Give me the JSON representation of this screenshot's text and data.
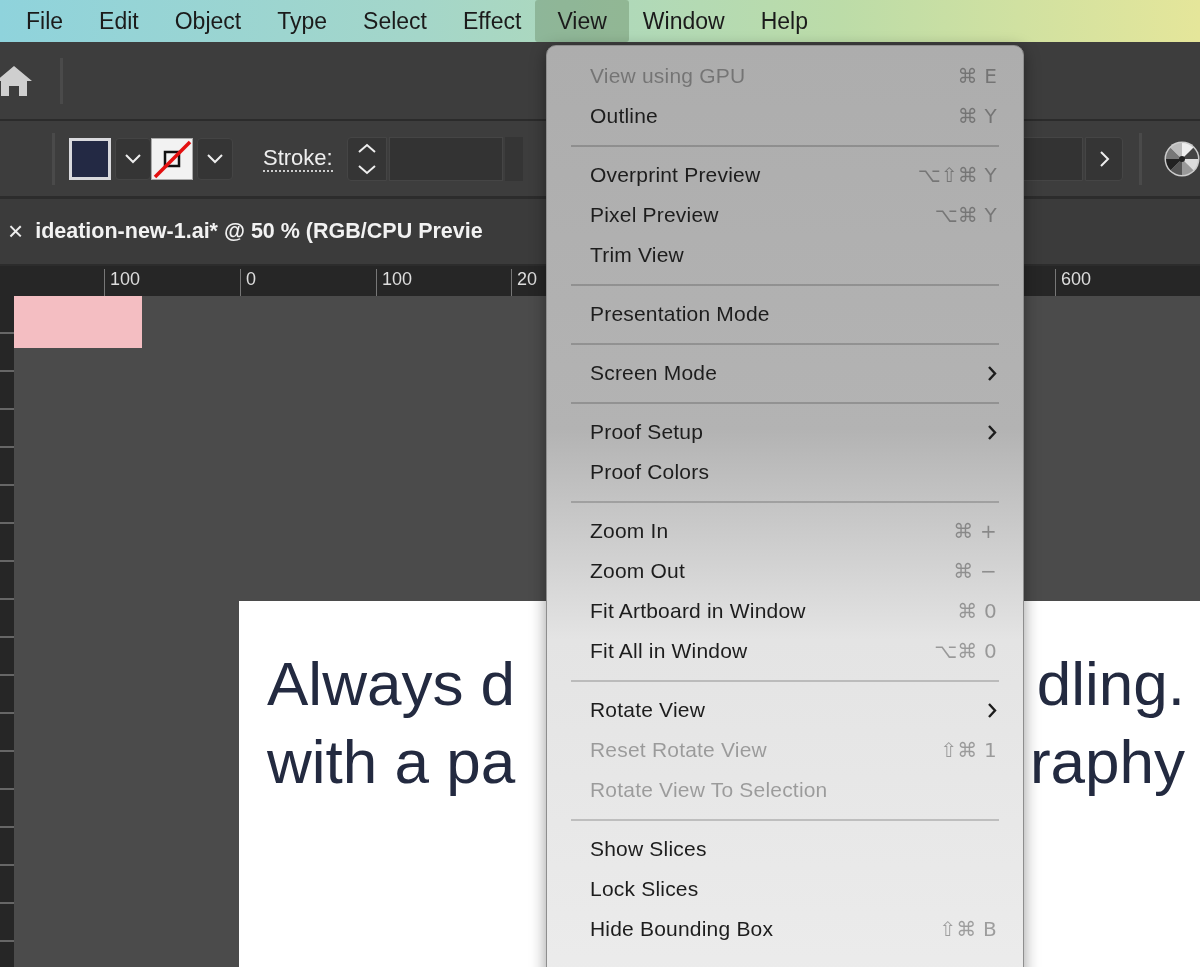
{
  "menu_bar": {
    "items": [
      {
        "label": "File",
        "selected": false
      },
      {
        "label": "Edit",
        "selected": false
      },
      {
        "label": "Object",
        "selected": false
      },
      {
        "label": "Type",
        "selected": false
      },
      {
        "label": "Select",
        "selected": false
      },
      {
        "label": "Effect",
        "selected": false
      },
      {
        "label": "View",
        "selected": true
      },
      {
        "label": "Window",
        "selected": false
      },
      {
        "label": "Help",
        "selected": false
      }
    ]
  },
  "control_bar": {
    "stroke_label": "Stroke:"
  },
  "document_tab": {
    "close": "×",
    "title": "ideation-new-1.ai* @ 50 % (RGB/CPU Previe"
  },
  "ruler": {
    "labels": [
      "100",
      "0",
      "100",
      "20",
      "600"
    ]
  },
  "artboard": {
    "lines": [
      {
        "left": "Always d",
        "right": "dling."
      },
      {
        "left": "with a pa",
        "right": "raphy"
      }
    ]
  },
  "view_menu": {
    "groups": [
      [
        {
          "label": "View using GPU",
          "shortcut": "⌘ E",
          "disabled": true,
          "submenu": false
        },
        {
          "label": "Outline",
          "shortcut": "⌘ Y",
          "disabled": false,
          "submenu": false
        }
      ],
      [
        {
          "label": "Overprint Preview",
          "shortcut": "⌥⇧⌘ Y",
          "disabled": false,
          "submenu": false
        },
        {
          "label": "Pixel Preview",
          "shortcut": "⌥⌘ Y",
          "disabled": false,
          "submenu": false
        },
        {
          "label": "Trim View",
          "disabled": false,
          "submenu": false
        }
      ],
      [
        {
          "label": "Presentation Mode",
          "disabled": false,
          "submenu": false
        }
      ],
      [
        {
          "label": "Screen Mode",
          "disabled": false,
          "submenu": true
        }
      ],
      [
        {
          "label": "Proof Setup",
          "disabled": false,
          "submenu": true
        },
        {
          "label": "Proof Colors",
          "disabled": false,
          "submenu": false
        }
      ],
      [
        {
          "label": "Zoom In",
          "shortcut": "⌘ +",
          "disabled": false,
          "submenu": false
        },
        {
          "label": "Zoom Out",
          "shortcut": "⌘ −",
          "disabled": false,
          "submenu": false
        },
        {
          "label": "Fit Artboard in Window",
          "shortcut": "⌘ 0",
          "disabled": false,
          "submenu": false
        },
        {
          "label": "Fit All in Window",
          "shortcut": "⌥⌘ 0",
          "disabled": false,
          "submenu": false
        }
      ],
      [
        {
          "label": "Rotate View",
          "disabled": false,
          "submenu": true
        },
        {
          "label": "Reset Rotate View",
          "shortcut": "⇧⌘ 1",
          "disabled": true,
          "submenu": false
        },
        {
          "label": "Rotate View To Selection",
          "disabled": true,
          "submenu": false
        }
      ],
      [
        {
          "label": "Show Slices",
          "disabled": false,
          "submenu": false
        },
        {
          "label": "Lock Slices",
          "disabled": false,
          "submenu": false
        },
        {
          "label": "Hide Bounding Box",
          "shortcut": "⇧⌘ B",
          "disabled": false,
          "submenu": false
        }
      ]
    ]
  }
}
